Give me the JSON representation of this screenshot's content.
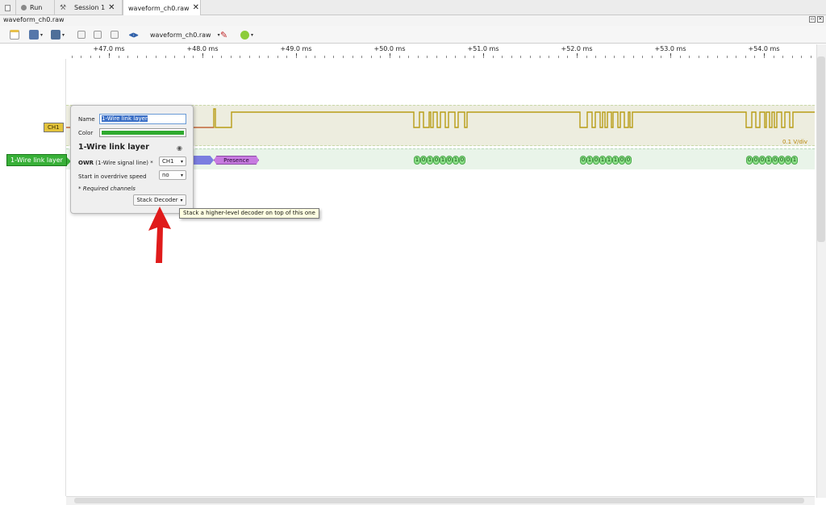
{
  "tabs": [
    {
      "label": ""
    },
    {
      "label": "Run"
    },
    {
      "label": ""
    },
    {
      "label": "Session 1"
    },
    {
      "label": "waveform_ch0.raw"
    }
  ],
  "window": {
    "file_title": "waveform_ch0.raw"
  },
  "toolbar": {
    "device_label": "waveform_ch0.raw"
  },
  "ruler": {
    "labels": [
      "+47.0 ms",
      "+48.0 ms",
      "+49.0 ms",
      "+50.0 ms",
      "+51.0 ms",
      "+52.0 ms",
      "+53.0 ms",
      "+54.0 ms"
    ]
  },
  "channels": {
    "ch1_label": "CH1",
    "decoder_label": "1-Wire link layer",
    "volt_div": "0.1 V/div",
    "colors": {
      "ch1": "#e3c33b",
      "decoder": "#38b038",
      "presence": "#c77be0",
      "reset": "#7a7ee0"
    }
  },
  "decoder_row": {
    "presence": "Presence",
    "bytes": [
      {
        "bits": [
          "1",
          "0",
          "1",
          "0",
          "1",
          "0",
          "1",
          "0"
        ]
      },
      {
        "bits": [
          "0",
          "1",
          "0",
          "1",
          "1",
          "1",
          "0",
          "0"
        ]
      },
      {
        "bits": [
          "0",
          "0",
          "0",
          "1",
          "0",
          "0",
          "0",
          "1"
        ]
      }
    ]
  },
  "popup": {
    "name_label": "Name",
    "name_value": "1-Wire link layer",
    "color_label": "Color",
    "color_value": "#2faa2f",
    "title": "1-Wire link layer",
    "owr_bold": "OWR",
    "owr_label": "(1-Wire signal line) *",
    "owr_value": "CH1",
    "overdrive_label": "Start in overdrive speed",
    "overdrive_value": "no",
    "required_note": "* Required channels",
    "stack_button": "Stack Decoder"
  },
  "tooltip": "Stack a higher-level decoder on top of this one"
}
